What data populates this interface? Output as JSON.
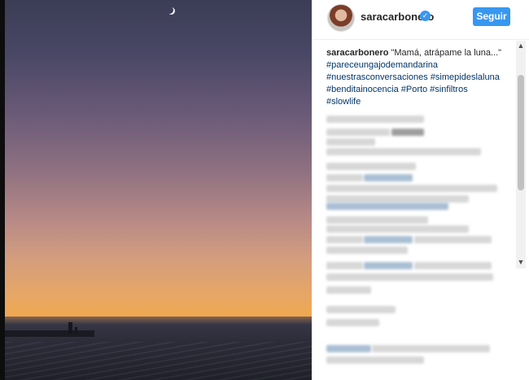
{
  "post": {
    "username": "saracarbonero",
    "verified_icon": "verified-badge-icon",
    "follow_label": "Seguir",
    "caption_author": "saracarbonero",
    "caption_text": " \"Mamá, atrápame la luna...\"",
    "hashtags": [
      "#pareceungajodemandarina",
      "#nuestrasconversaciones",
      "#simepideslaluna",
      "#benditainocencia",
      "#Porto",
      "#sinfiltros",
      "#slowlife"
    ]
  },
  "colors": {
    "accent": "#3897f0",
    "hashtag": "#003569",
    "text": "#262626"
  },
  "scrollbar": {
    "up_icon": "chevron-up-icon",
    "down_icon": "chevron-down-icon"
  }
}
